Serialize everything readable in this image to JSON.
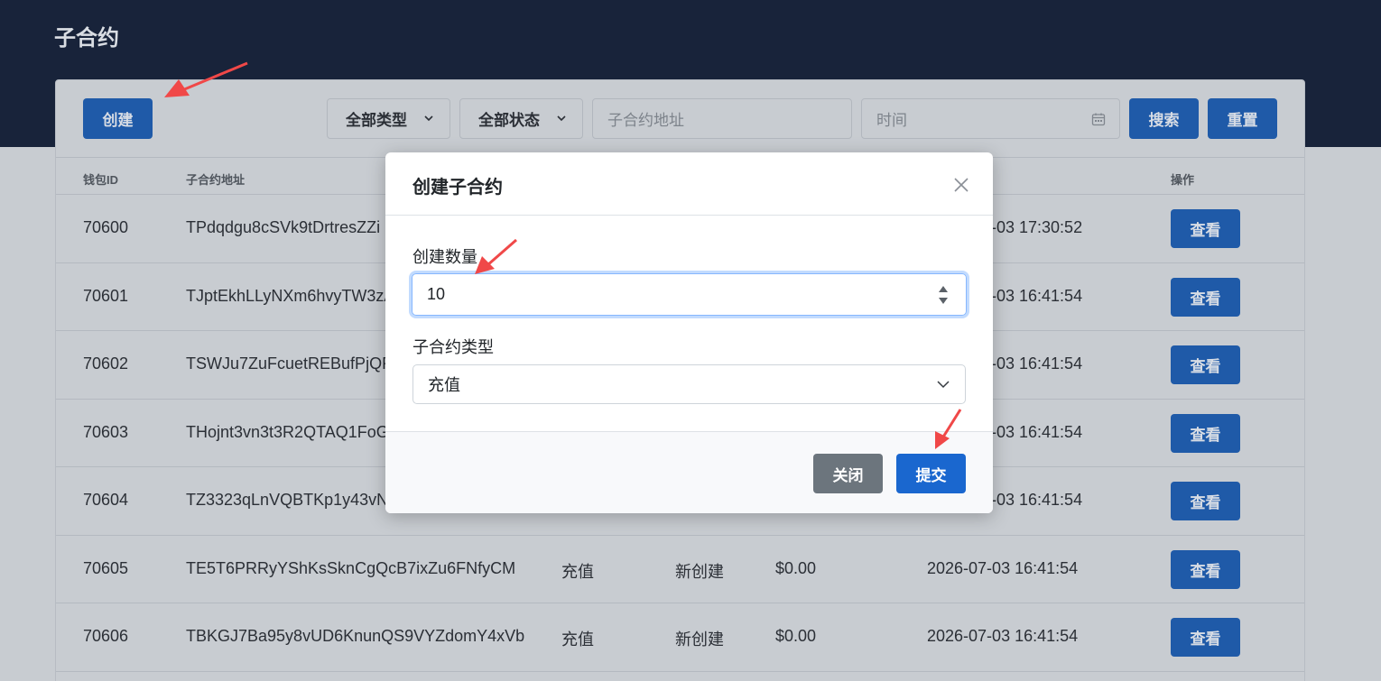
{
  "page": {
    "title": "子合约"
  },
  "toolbar": {
    "create_label": "创建",
    "type_filter": "全部类型",
    "status_filter": "全部状态",
    "address_placeholder": "子合约地址",
    "time_placeholder": "时间",
    "search_label": "搜索",
    "reset_label": "重置"
  },
  "table": {
    "headers": {
      "wallet_id": "钱包ID",
      "address": "子合约地址",
      "action": "操作"
    },
    "view_label": "查看",
    "rows": [
      {
        "id": "70600",
        "address": "TPdqdgu8cSVk9tDrtresZZi",
        "type": "",
        "status": "",
        "amount": "",
        "time": "-03 17:30:52"
      },
      {
        "id": "70601",
        "address": "TJptEkhLLyNXm6hvyTW3zA",
        "type": "",
        "status": "",
        "amount": "",
        "time": "-03 16:41:54"
      },
      {
        "id": "70602",
        "address": "TSWJu7ZuFcuetREBufPjQR",
        "type": "",
        "status": "",
        "amount": "",
        "time": "-03 16:41:54"
      },
      {
        "id": "70603",
        "address": "THojnt3vn3t3R2QTAQ1FoG",
        "type": "",
        "status": "",
        "amount": "",
        "time": "-03 16:41:54"
      },
      {
        "id": "70604",
        "address": "TZ3323qLnVQBTKp1y43vN",
        "type": "",
        "status": "",
        "amount": "",
        "time": "-03 16:41:54"
      },
      {
        "id": "70605",
        "address": "TE5T6PRRyYShKsSknCgQcB7ixZu6FNfyCM",
        "type": "充值",
        "status": "新创建",
        "amount": "$0.00",
        "time": "2026-07-03 16:41:54"
      },
      {
        "id": "70606",
        "address": "TBKGJ7Ba95y8vUD6KnunQS9VYZdomY4xVb",
        "type": "充值",
        "status": "新创建",
        "amount": "$0.00",
        "time": "2026-07-03 16:41:54"
      }
    ]
  },
  "modal": {
    "title": "创建子合约",
    "quantity_label": "创建数量",
    "quantity_value": "10",
    "type_label": "子合约类型",
    "type_value": "充值",
    "close_label": "关闭",
    "submit_label": "提交"
  },
  "colors": {
    "topbar": "#18233a",
    "primary": "#1f5aa8",
    "annotation_arrow": "#f04848"
  },
  "icons": [
    "chevron-down-icon",
    "calendar-icon",
    "close-icon",
    "spinner-icon",
    "annotation-arrow"
  ]
}
